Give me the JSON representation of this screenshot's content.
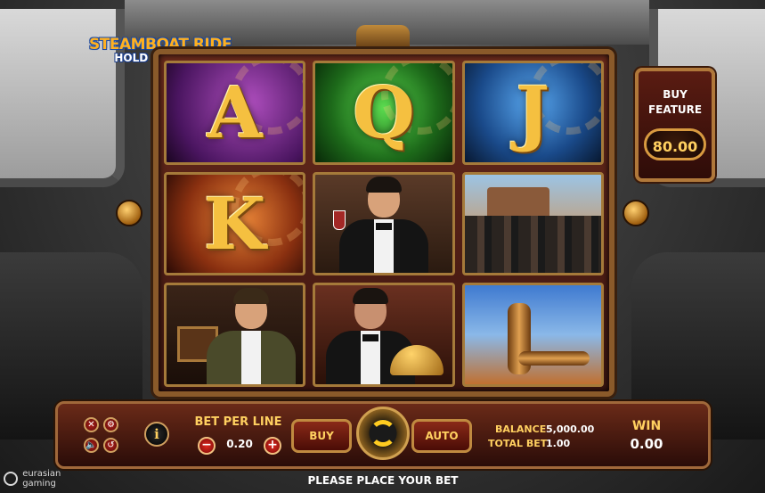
{
  "logo": {
    "line1": "STEAMBOAT RIDE",
    "line2": "HOLD AND WIN"
  },
  "reels": {
    "symbols": [
      {
        "id": "A",
        "kind": "letter",
        "label": "A"
      },
      {
        "id": "Q",
        "kind": "letter",
        "label": "Q"
      },
      {
        "id": "J",
        "kind": "letter",
        "label": "J"
      },
      {
        "id": "K",
        "kind": "letter",
        "label": "K"
      },
      {
        "id": "gentleman",
        "kind": "picture"
      },
      {
        "id": "crowd",
        "kind": "picture"
      },
      {
        "id": "photographer",
        "kind": "picture"
      },
      {
        "id": "waiter",
        "kind": "picture"
      },
      {
        "id": "steam-pipe",
        "kind": "picture"
      }
    ]
  },
  "buy_feature": {
    "label_line1": "BUY",
    "label_line2": "FEATURE",
    "price": "80.00"
  },
  "controls": {
    "bet_per_line_label": "BET PER LINE",
    "bet_per_line_value": "0.20",
    "minus": "−",
    "plus": "+",
    "buy_label": "BUY",
    "auto_label": "AUTO",
    "info_label": "i",
    "balance_label": "BALANCE",
    "balance_value": "5,000.00",
    "total_bet_label": "TOTAL BET",
    "total_bet_value": "1.00",
    "win_label": "WIN",
    "win_value": "0.00",
    "icons": [
      "close-icon",
      "settings-icon",
      "sound-icon",
      "history-icon"
    ],
    "icon_glyphs": [
      "✕",
      "⚙",
      "🔈",
      "↺"
    ]
  },
  "status_message": "PLEASE PLACE YOUR BET",
  "brand": {
    "line1": "eurasian",
    "line2": "gaming"
  },
  "colors": {
    "gold": "#ffd060",
    "frame": "#a0683a",
    "panel": "#6a2a18"
  }
}
